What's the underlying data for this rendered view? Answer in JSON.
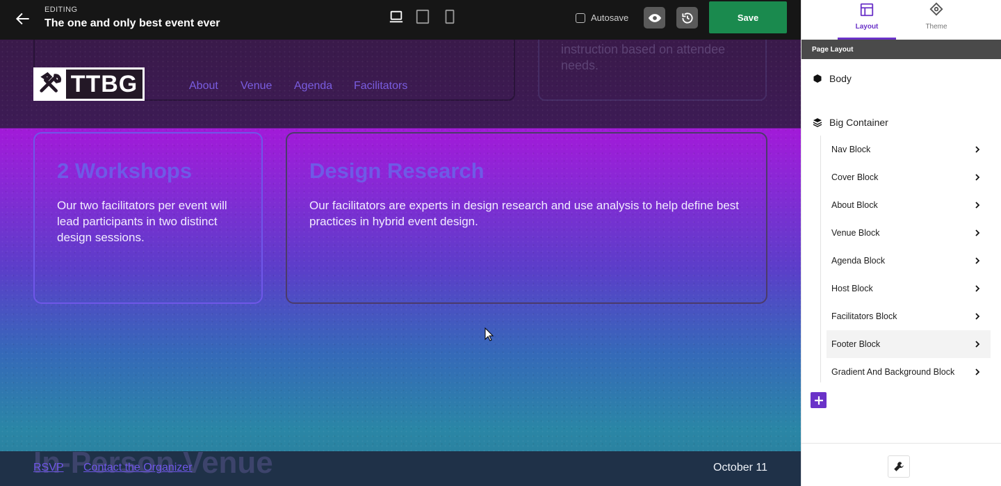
{
  "topbar": {
    "editing_label": "EDITING",
    "title": "The one and only best event ever",
    "devices": [
      "desktop-icon",
      "tablet-icon",
      "mobile-icon"
    ],
    "autosave_label": "Autosave",
    "autosave_checked": false,
    "save_label": "Save"
  },
  "site": {
    "logo_text": "TTBG",
    "nav": [
      "About",
      "Venue",
      "Agenda",
      "Facilitators"
    ],
    "ghost_text": "instruction based on attendee needs.",
    "cards": [
      {
        "title": "2 Workshops",
        "body": "Our two facilitators per event will lead participants in two distinct design sessions."
      },
      {
        "title": "Design Research",
        "body": "Our facilitators are experts in design research and use analysis to help define best practices in hybrid event design."
      }
    ],
    "footer": {
      "ghost_heading": "In-Person Venue",
      "links": [
        "RSVP",
        "Contact the Organizer"
      ],
      "date": "October 11"
    }
  },
  "panel": {
    "tabs": [
      {
        "label": "Layout",
        "icon": "layout-icon",
        "active": true
      },
      {
        "label": "Theme",
        "icon": "theme-icon",
        "active": false
      }
    ],
    "section_title": "Page Layout",
    "body_label": "Body",
    "container_label": "Big Container",
    "blocks": [
      "Nav Block",
      "Cover Block",
      "About Block",
      "Venue Block",
      "Agenda Block",
      "Host Block",
      "Facilitators Block",
      "Footer Block",
      "Gradient And Background Block"
    ],
    "hovered_block": "Footer Block"
  },
  "colors": {
    "accent": "#6a32c8",
    "save_green": "#1a8a4e",
    "topbar": "#161616",
    "link": "#7a5de0"
  }
}
